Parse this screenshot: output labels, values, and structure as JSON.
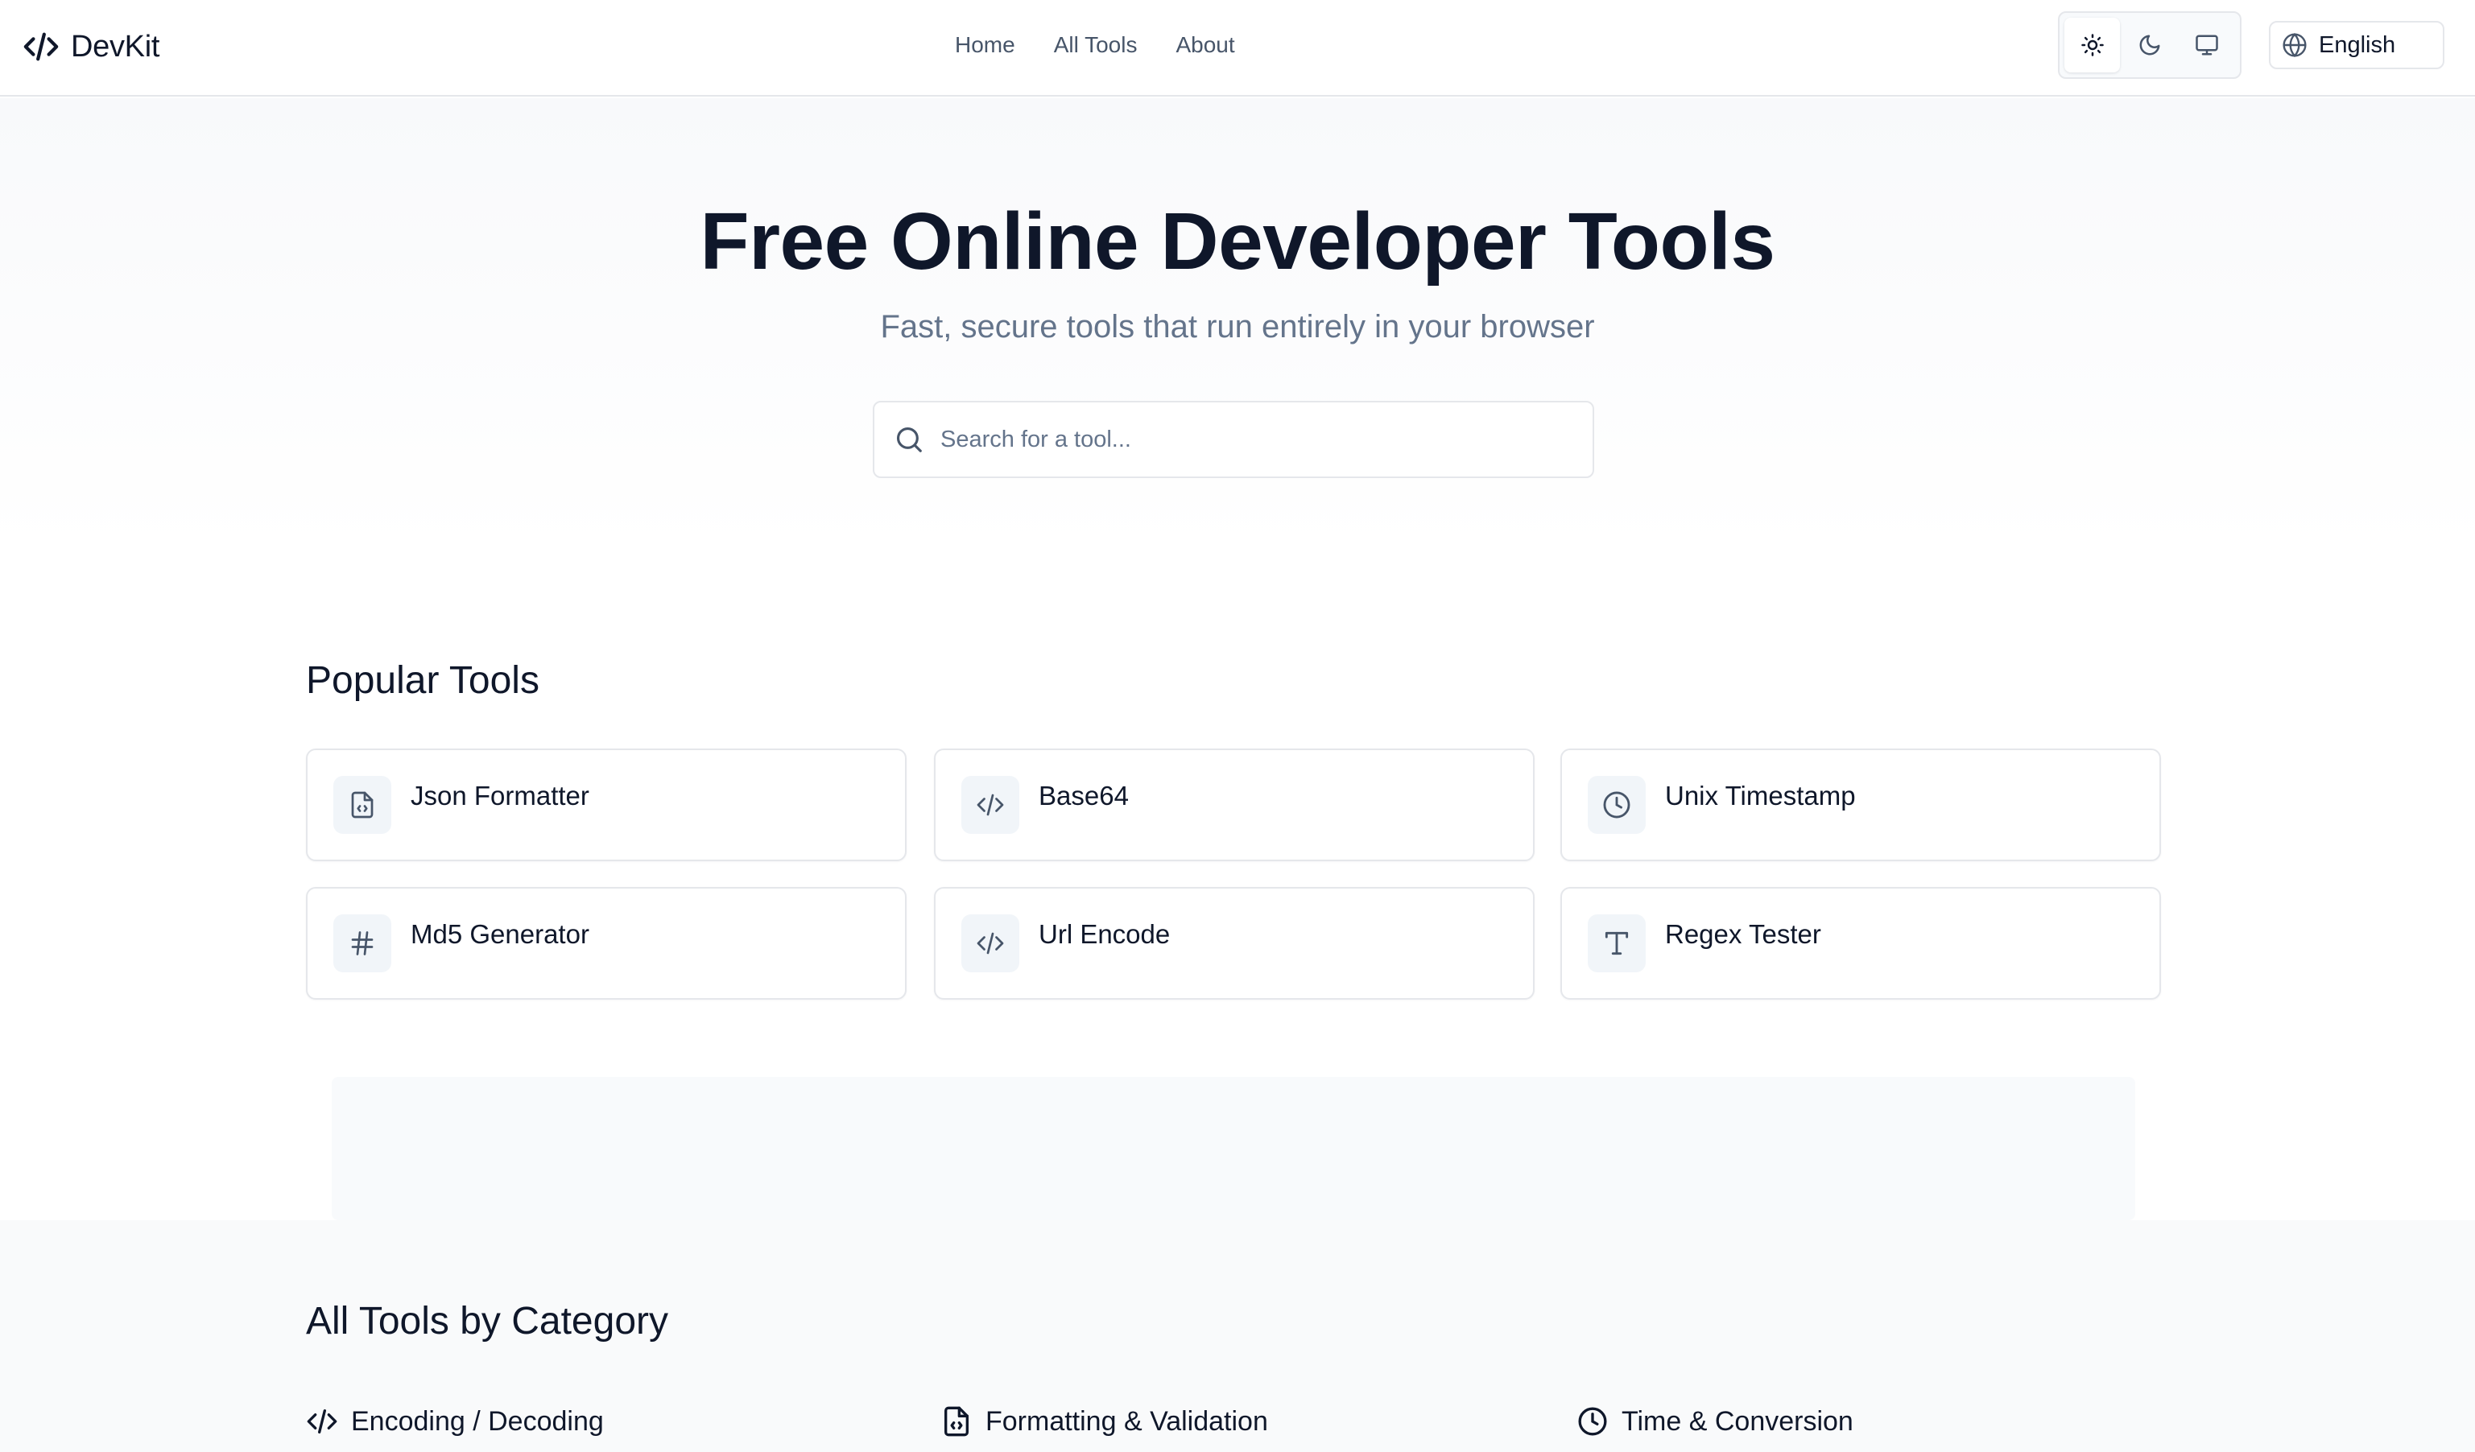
{
  "header": {
    "brand": "DevKit",
    "nav": [
      {
        "label": "Home"
      },
      {
        "label": "All Tools"
      },
      {
        "label": "About"
      }
    ],
    "theme_options": [
      "sun-icon",
      "moon-icon",
      "monitor-icon"
    ],
    "theme_selected": "light",
    "language": "English"
  },
  "hero": {
    "title": "Free Online Developer Tools",
    "subtitle": "Fast, secure tools that run entirely in your browser",
    "search_placeholder": "Search for a tool..."
  },
  "popular": {
    "title": "Popular Tools",
    "tools": [
      {
        "label": "Json Formatter",
        "icon": "file-code-icon"
      },
      {
        "label": "Base64",
        "icon": "code-icon"
      },
      {
        "label": "Unix Timestamp",
        "icon": "clock-icon"
      },
      {
        "label": "Md5 Generator",
        "icon": "hash-icon"
      },
      {
        "label": "Url Encode",
        "icon": "code-icon"
      },
      {
        "label": "Regex Tester",
        "icon": "type-icon"
      }
    ]
  },
  "categories": {
    "title": "All Tools by Category",
    "items": [
      {
        "label": "Encoding / Decoding",
        "icon": "code-icon"
      },
      {
        "label": "Formatting & Validation",
        "icon": "file-code-icon"
      },
      {
        "label": "Time & Conversion",
        "icon": "clock-icon"
      }
    ]
  },
  "colors": {
    "text": "#0f172a",
    "muted": "#64748b",
    "nav": "#475569",
    "border": "#e5e7eb",
    "icon_bg": "#f1f5f9"
  }
}
